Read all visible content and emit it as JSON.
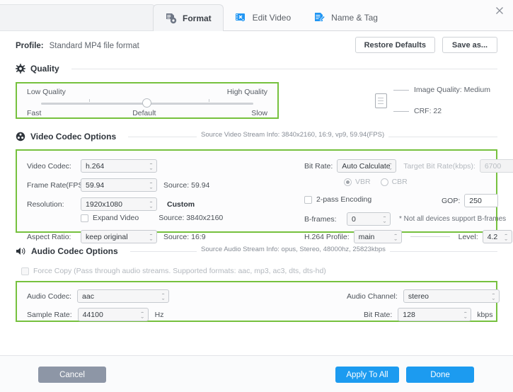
{
  "window": {
    "close_icon": "close-icon"
  },
  "tabs": [
    {
      "label": "Format",
      "icon": "document-gear-icon",
      "active": true
    },
    {
      "label": "Edit Video",
      "icon": "film-scissors-icon",
      "active": false
    },
    {
      "label": "Name & Tag",
      "icon": "document-pencil-icon",
      "active": false
    }
  ],
  "profile": {
    "label": "Profile:",
    "value": "Standard MP4 file format",
    "restore_defaults": "Restore Defaults",
    "save_as": "Save as..."
  },
  "quality": {
    "section_title": "Quality",
    "section_icon": "gear-icon",
    "left_top": "Low Quality",
    "right_top": "High Quality",
    "left_bottom": "Fast",
    "center_bottom": "Default",
    "right_bottom": "Slow",
    "slider_position_percent": 50,
    "image_quality": "Image Quality: Medium",
    "crf": "CRF: 22",
    "doc_icon": "document-icon"
  },
  "video": {
    "section_title": "Video Codec Options",
    "section_icon": "film-reel-icon",
    "source_info": "Source Video Stream Info: 3840x2160, 16:9, vp9, 59.94(FPS)",
    "codec_label": "Video Codec:",
    "codec_value": "h.264",
    "framerate_label": "Frame Rate(FPS):",
    "framerate_value": "59.94",
    "framerate_source": "Source: 59.94",
    "resolution_label": "Resolution:",
    "resolution_value": "1920x1080",
    "resolution_custom": "Custom",
    "expand_video_label": "Expand Video",
    "expand_video_checked": false,
    "resolution_source": "Source: 3840x2160",
    "aspect_label": "Aspect Ratio:",
    "aspect_value": "keep original",
    "aspect_source": "Source: 16:9",
    "bitrate_label": "Bit Rate:",
    "bitrate_value": "Auto Calculate",
    "target_bitrate_label": "Target Bit Rate(kbps):",
    "target_bitrate_value": "6700",
    "vbr_label": "VBR",
    "cbr_label": "CBR",
    "vbr_selected": true,
    "twopass_label": "2-pass Encoding",
    "twopass_checked": false,
    "gop_label": "GOP:",
    "gop_value": "250",
    "bframes_label": "B-frames:",
    "bframes_value": "0",
    "bframes_note": "* Not all devices support B-frames",
    "profile_label": "H.264 Profile:",
    "profile_value": "main",
    "level_label": "Level:",
    "level_value": "4.2"
  },
  "audio": {
    "section_title": "Audio Codec Options",
    "section_icon": "speaker-icon",
    "source_info": "Source Audio Stream Info: opus, Stereo, 48000hz, 25823kbps",
    "force_copy_label": "Force Copy (Pass through audio streams. Supported formats: aac, mp3, ac3, dts, dts-hd)",
    "force_copy_checked": false,
    "codec_label": "Audio Codec:",
    "codec_value": "aac",
    "channel_label": "Audio Channel:",
    "channel_value": "stereo",
    "samplerate_label": "Sample Rate:",
    "samplerate_value": "44100",
    "samplerate_unit": "Hz",
    "bitrate_label": "Bit Rate:",
    "bitrate_value": "128",
    "bitrate_unit": "kbps"
  },
  "footer": {
    "cancel": "Cancel",
    "apply_to_all": "Apply To All",
    "done": "Done"
  },
  "colors": {
    "highlight_green": "#76c13e",
    "primary_blue": "#1c9bf0",
    "cancel_gray": "#8d96a6",
    "tab_icon_blue": "#2196f3"
  }
}
